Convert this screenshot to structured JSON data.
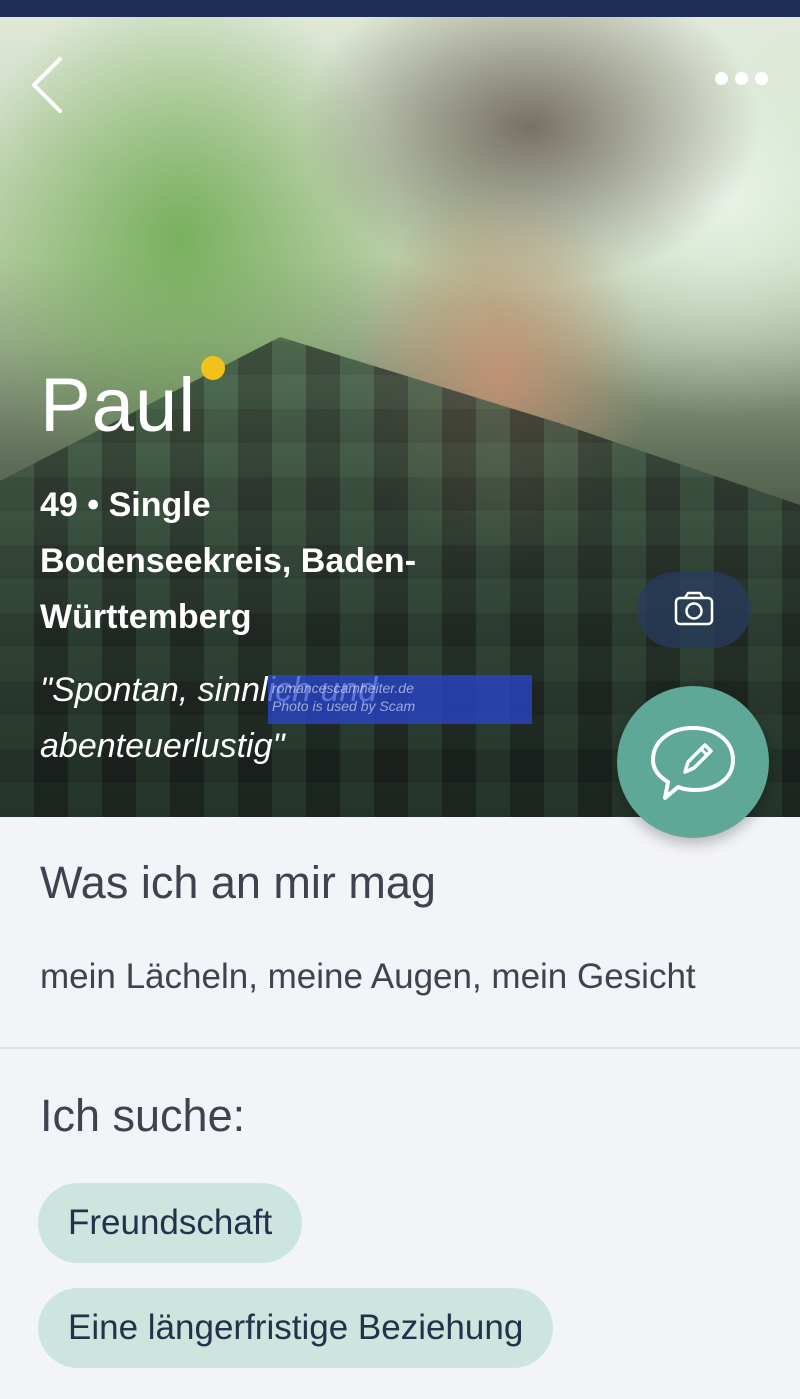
{
  "profile": {
    "name": "Paul",
    "age_status": "49 • Single",
    "location": "Bodenseekreis, Baden-Württemberg",
    "quote": "\"Spontan, sinnlich und abenteuerlustig\"",
    "watermark_line1": "romancescamheiter.de",
    "watermark_line2": "Photo is used by Scam"
  },
  "sections": {
    "likes_title": "Was ich an mir mag",
    "likes_text": "mein Lächeln, meine Augen, mein Gesicht",
    "seeking_title": "Ich suche:",
    "seeking_chips": [
      "Freundschaft",
      "Eine längerfristige Beziehung"
    ]
  },
  "colors": {
    "status_bar": "#1f2e55",
    "online_dot": "#f2c21a",
    "fab": "#5fa898",
    "chip_bg": "#cde5df"
  },
  "icons": [
    "back-chevron-icon",
    "more-dots-icon",
    "camera-icon",
    "chat-edit-icon"
  ]
}
